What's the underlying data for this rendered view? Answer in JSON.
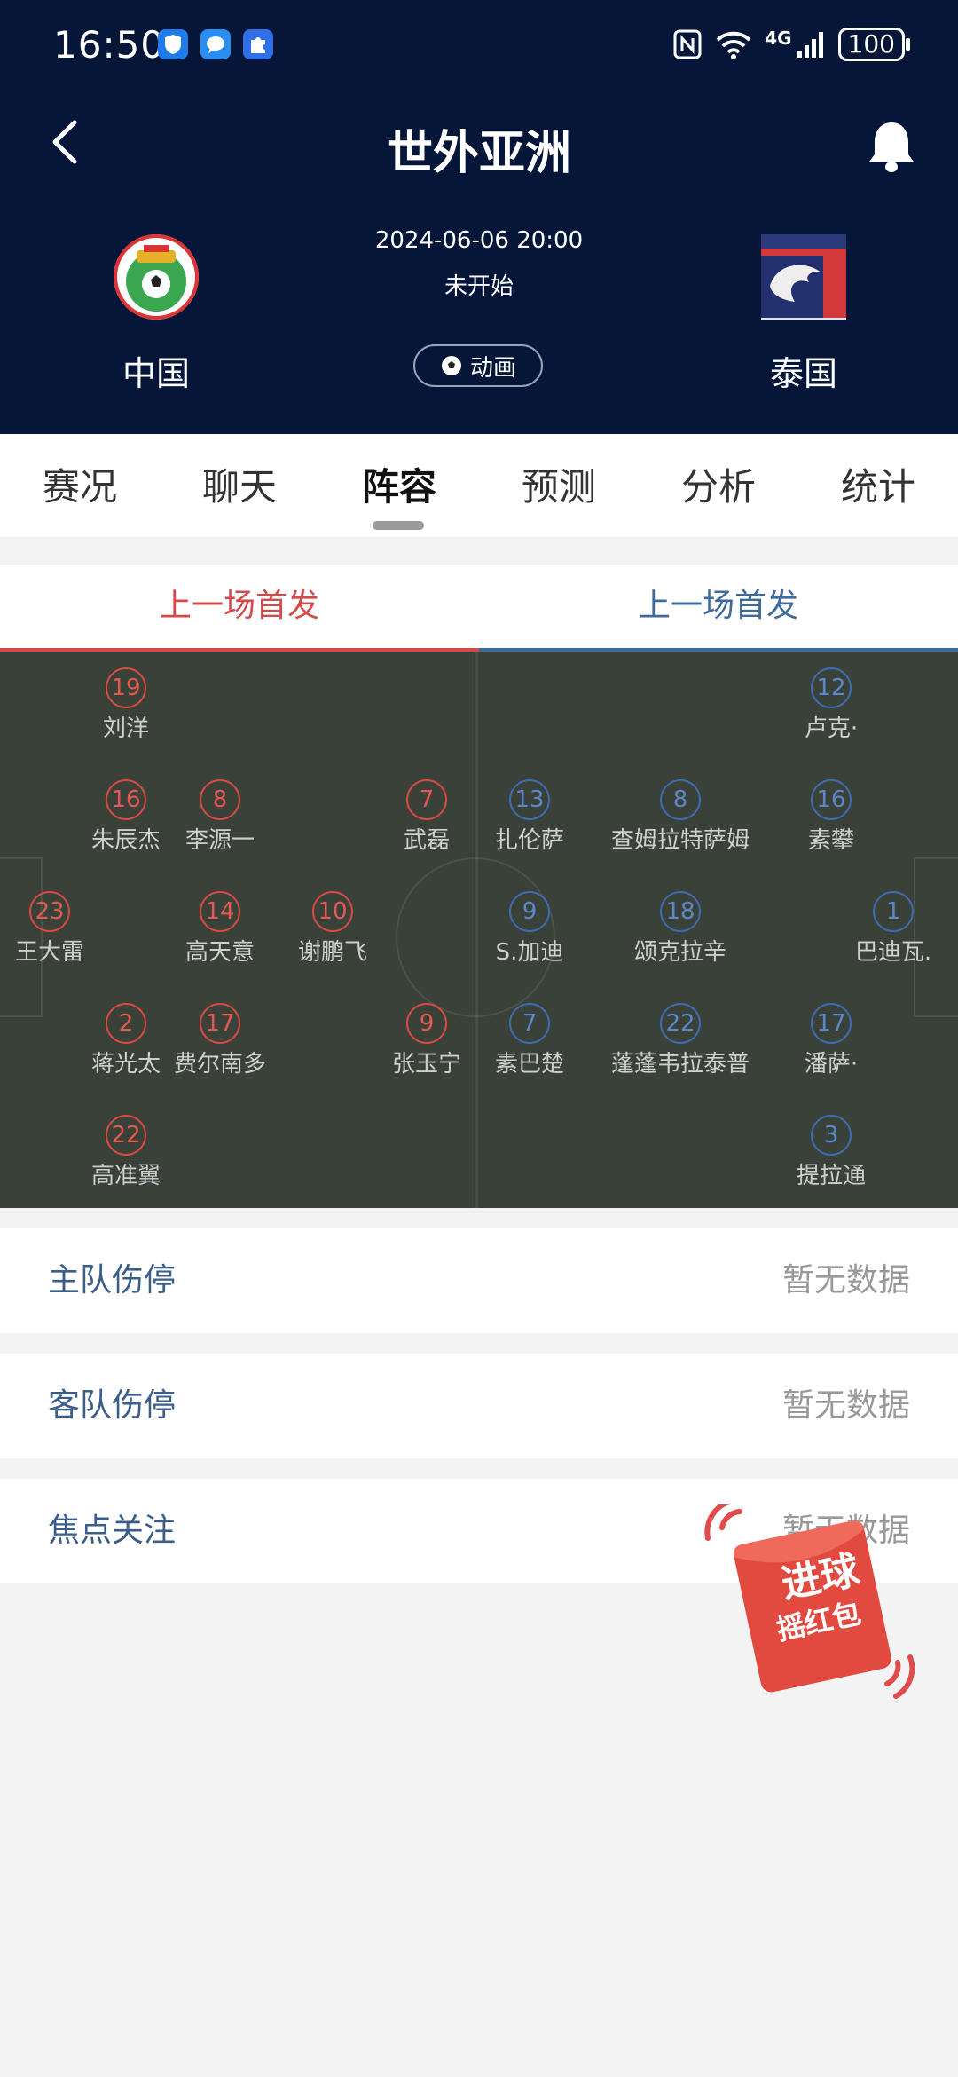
{
  "status_bar": {
    "time": "16:50",
    "signal": "4G",
    "battery": "100"
  },
  "header": {
    "title": "世外亚洲"
  },
  "match": {
    "datetime": "2024-06-06 20:00",
    "status": "未开始",
    "animation_label": "动画",
    "home_team": "中国",
    "away_team": "泰国"
  },
  "tabs": [
    "赛况",
    "聊天",
    "阵容",
    "预测",
    "分析",
    "统计"
  ],
  "active_tab": "阵容",
  "lineup_tabs": {
    "home": "上一场首发",
    "away": "上一场首发"
  },
  "colors": {
    "header_bg": "#051638",
    "home": "#d24a4a",
    "away": "#3f6a9c",
    "pitch": "#394138"
  },
  "home_players": [
    {
      "num": "19",
      "name": "刘洋"
    },
    {
      "num": "16",
      "name": "朱辰杰"
    },
    {
      "num": "8",
      "name": "李源一"
    },
    {
      "num": "7",
      "name": "武磊"
    },
    {
      "num": "23",
      "name": "王大雷"
    },
    {
      "num": "14",
      "name": "高天意"
    },
    {
      "num": "10",
      "name": "谢鹏飞"
    },
    {
      "num": "2",
      "name": "蒋光太"
    },
    {
      "num": "17",
      "name": "费尔南多"
    },
    {
      "num": "9",
      "name": "张玉宁"
    },
    {
      "num": "22",
      "name": "高准翼"
    }
  ],
  "away_players": [
    {
      "num": "12",
      "name": "卢克·"
    },
    {
      "num": "13",
      "name": "扎伦萨"
    },
    {
      "num": "8",
      "name": "查姆拉特萨姆"
    },
    {
      "num": "16",
      "name": "素攀"
    },
    {
      "num": "9",
      "name": "S.加迪"
    },
    {
      "num": "18",
      "name": "颂克拉辛"
    },
    {
      "num": "1",
      "name": "巴迪瓦."
    },
    {
      "num": "7",
      "name": "素巴楚"
    },
    {
      "num": "22",
      "name": "蓬蓬韦拉泰普"
    },
    {
      "num": "17",
      "name": "潘萨·"
    },
    {
      "num": "3",
      "name": "提拉通"
    }
  ],
  "info_rows": [
    {
      "label": "主队伤停",
      "value": "暂无数据"
    },
    {
      "label": "客队伤停",
      "value": "暂无数据"
    },
    {
      "label": "焦点关注",
      "value": "暂无数据"
    }
  ],
  "promo": {
    "line1": "进球",
    "line2": "摇红包"
  }
}
